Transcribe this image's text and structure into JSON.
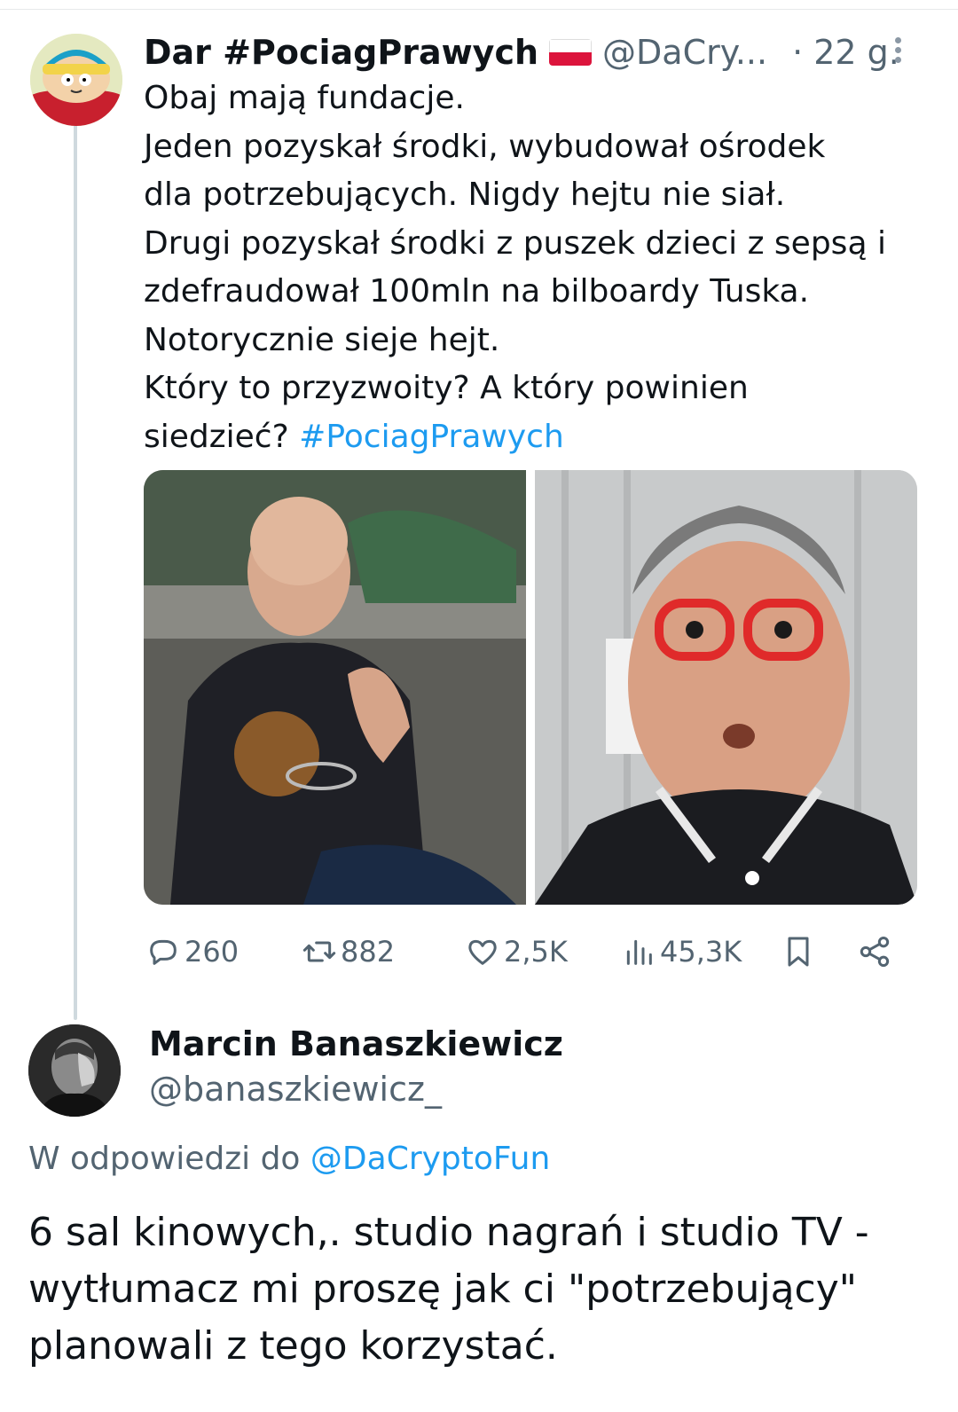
{
  "tweet": {
    "author_name": "Dar #PociagPrawych",
    "handle": "@DaCry...",
    "time": "· 22 g.",
    "text_lines": [
      "Obaj mają fundacje.",
      "Jeden pozyskał środki, wybudował ośrodek",
      "dla potrzebujących. Nigdy hejtu nie siał.",
      "Drugi pozyskał środki z puszek dzieci z sepsą i",
      "zdefraudował 100mln na bilboardy Tuska.",
      "Notorycznie sieje hejt.",
      "Który to przyzwoity? A który powinien"
    ],
    "last_line_text": "siedzieć? ",
    "hashtag": "#PociagPrawych",
    "stats": {
      "replies": "260",
      "retweets": "882",
      "likes": "2,5K",
      "views": "45,3K"
    }
  },
  "reply": {
    "author_name": "Marcin Banaszkiewicz",
    "handle": "@banaszkiewicz_",
    "in_reply_prefix": "W odpowiedzi do ",
    "in_reply_mention": "@DaCryptoFun",
    "text_lines": [
      "6 sal kinowych,. studio nagrań i studio TV -",
      "wytłumacz mi proszę jak ci \"potrzebujący\"",
      "planowali z tego korzystać."
    ]
  },
  "colors": {
    "link": "#1d9bf0",
    "secondary": "#536471",
    "primary": "#0f1419"
  }
}
